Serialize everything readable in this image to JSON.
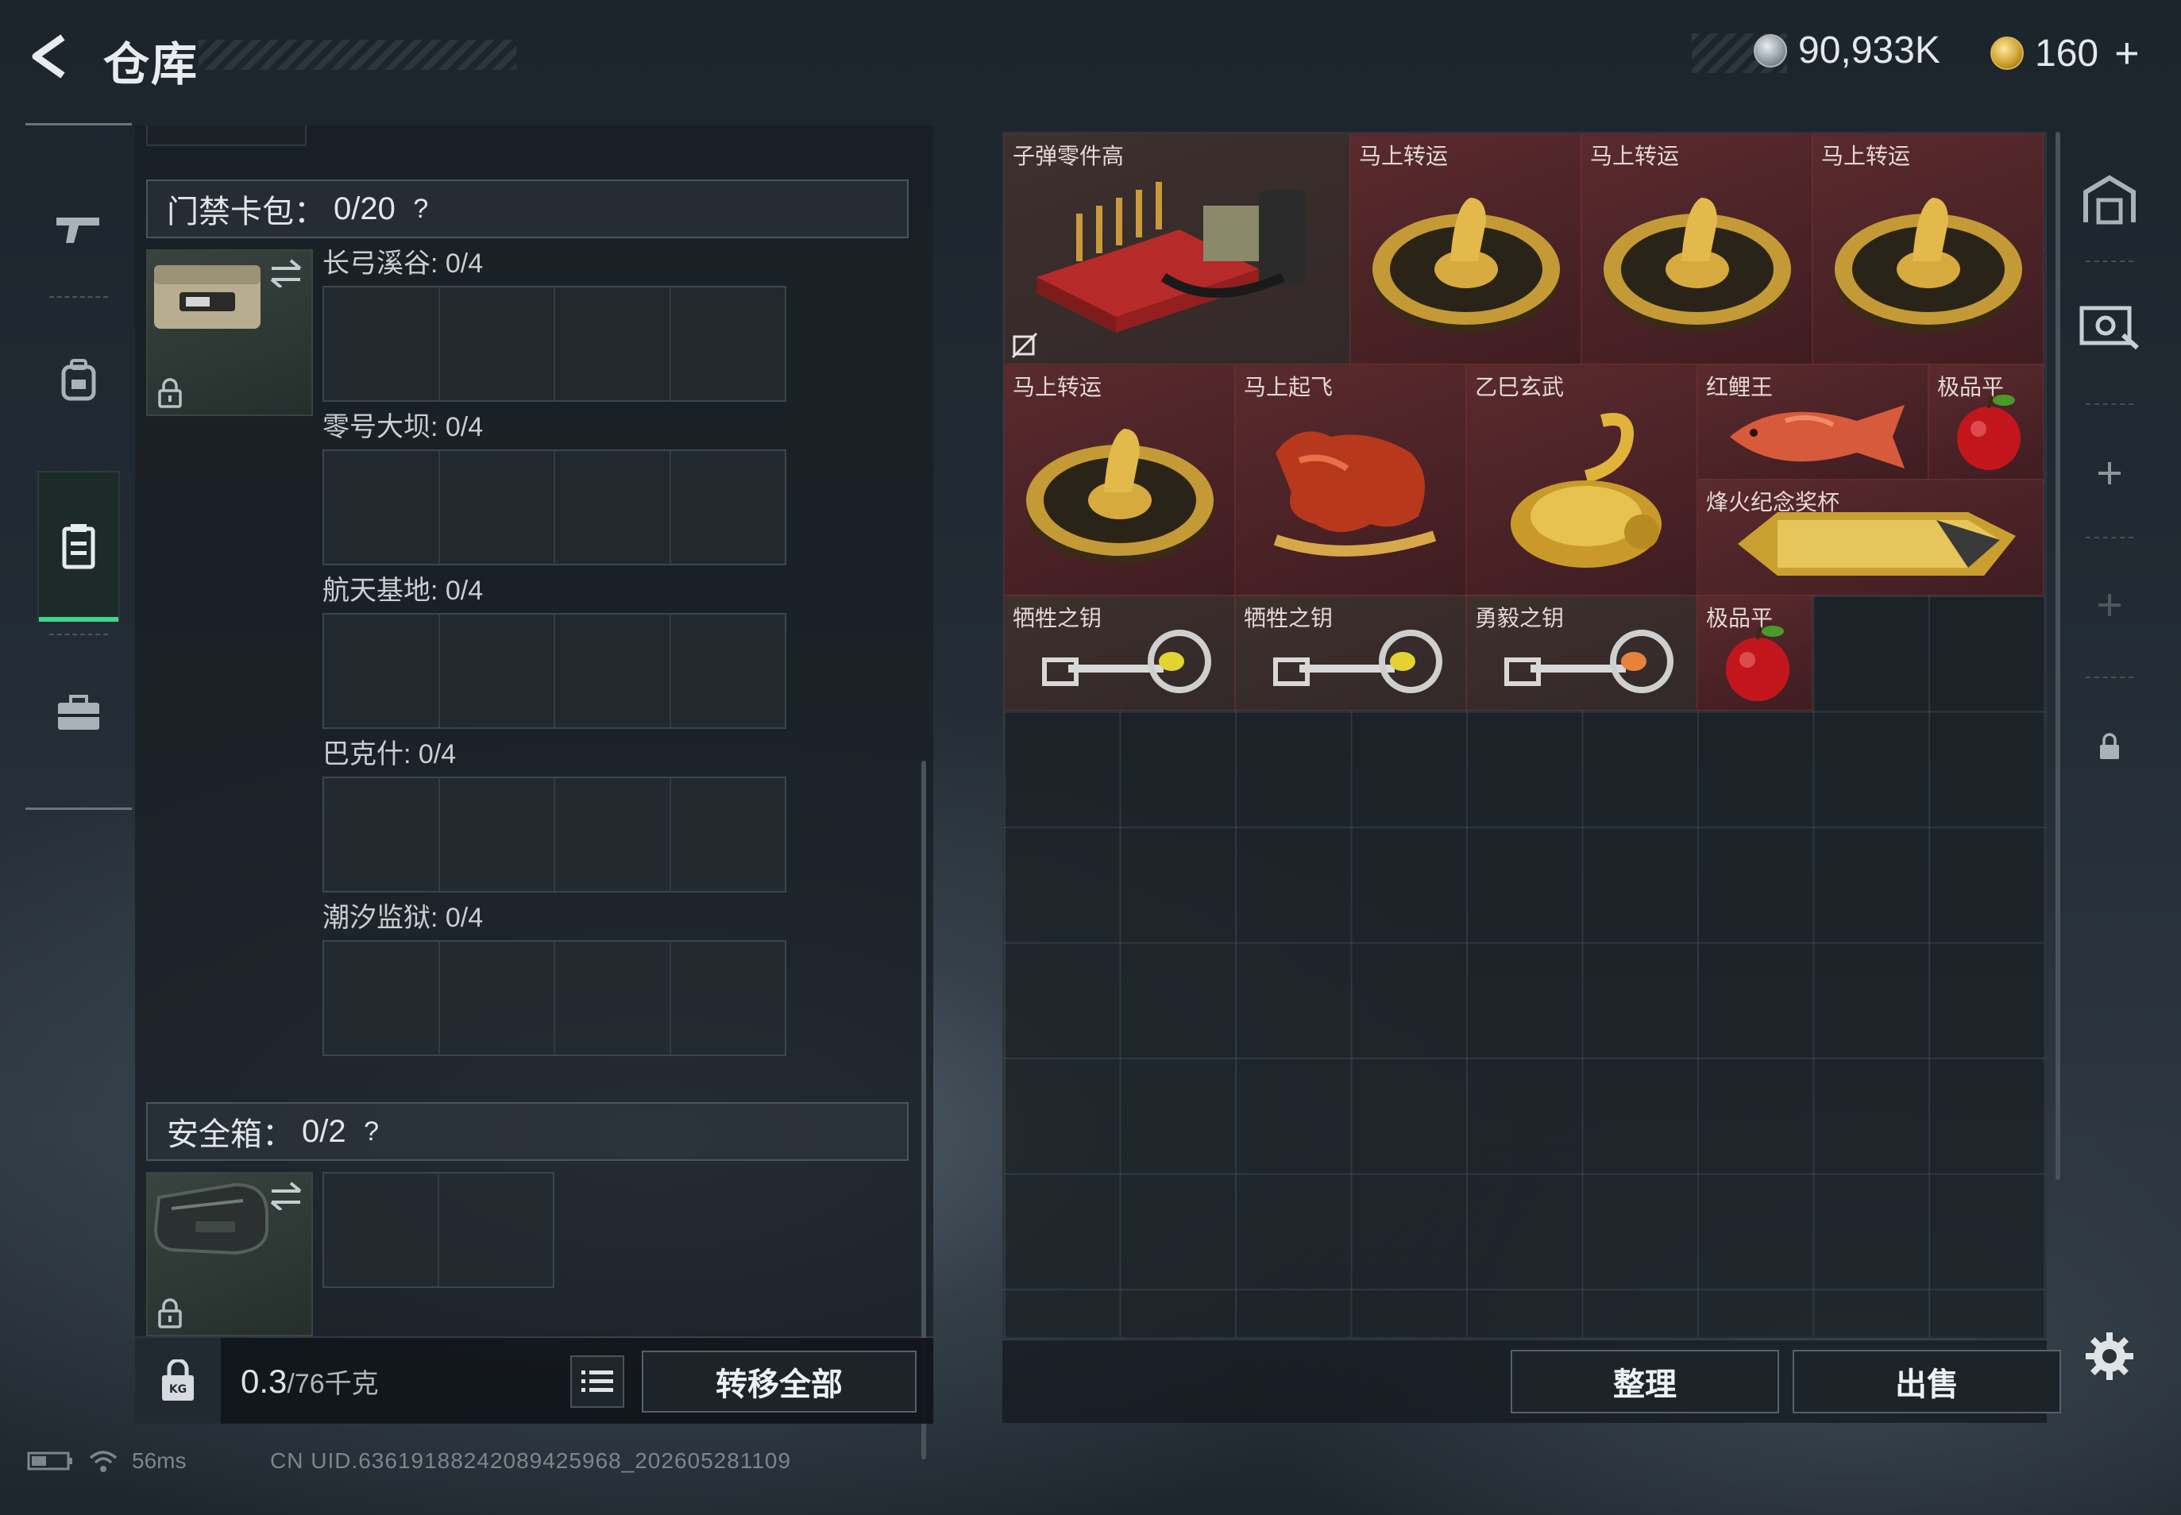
{
  "header": {
    "title": "仓库",
    "currency_silver": "90,933K",
    "currency_gold": "160",
    "plus": "+"
  },
  "left_tabs": [
    {
      "name": "weapons",
      "icon": "gun-icon",
      "active": false
    },
    {
      "name": "backpack",
      "icon": "backpack-icon",
      "active": false
    },
    {
      "name": "container",
      "icon": "container-icon",
      "active": true
    },
    {
      "name": "case",
      "icon": "briefcase-icon",
      "active": false
    }
  ],
  "card_pack": {
    "label": "门禁卡包：",
    "count": "0/20",
    "help": "?",
    "slots": [
      {
        "label": "长弓溪谷: 0/4"
      },
      {
        "label": "零号大坝: 0/4"
      },
      {
        "label": "航天基地: 0/4"
      },
      {
        "label": "巴克什: 0/4"
      },
      {
        "label": "潮汐监狱: 0/4"
      }
    ]
  },
  "safe_box": {
    "label": "安全箱：",
    "count": "0/2",
    "help": "?"
  },
  "footer_left": {
    "weight_value": "0.3",
    "weight_max": "/76千克",
    "transfer_label": "转移全部"
  },
  "items": [
    {
      "name": "子弹零件高",
      "icon": "ammo-parts-crate-icon"
    },
    {
      "name": "马上转运",
      "icon": "horse-coin-icon"
    },
    {
      "name": "马上转运",
      "icon": "horse-coin-icon"
    },
    {
      "name": "马上转运",
      "icon": "horse-coin-icon"
    },
    {
      "name": "马上转运",
      "icon": "horse-coin-icon"
    },
    {
      "name": "马上起飞",
      "icon": "red-horse-statue-icon"
    },
    {
      "name": "乙巳玄武",
      "icon": "golden-snake-tortoise-icon"
    },
    {
      "name": "红鲤王",
      "icon": "red-carp-icon"
    },
    {
      "name": "极品平",
      "icon": "red-apple-icon"
    },
    {
      "name": "烽火纪念奖杯",
      "icon": "memorial-trophy-icon"
    },
    {
      "name": "牺牲之钥",
      "icon": "key-yellow-gem-icon"
    },
    {
      "name": "牺牲之钥",
      "icon": "key-yellow-gem-icon"
    },
    {
      "name": "勇毅之钥",
      "icon": "key-orange-gem-icon"
    },
    {
      "name": "极品平",
      "icon": "red-apple-icon"
    }
  ],
  "footer_right": {
    "sort_label": "整理",
    "sell_label": "出售"
  },
  "right_sidebar": [
    "garage-icon",
    "bulk-sell-icon",
    "add-icon",
    "add-icon",
    "lock-icon"
  ],
  "status": {
    "ping": "56ms",
    "uid": "CN UID.6361918824208942596​8_202605281109"
  },
  "colors": {
    "accent_green": "#3fd68c",
    "item_red_bg": "#5a2a2e",
    "item_brown_bg": "#3d302c"
  }
}
